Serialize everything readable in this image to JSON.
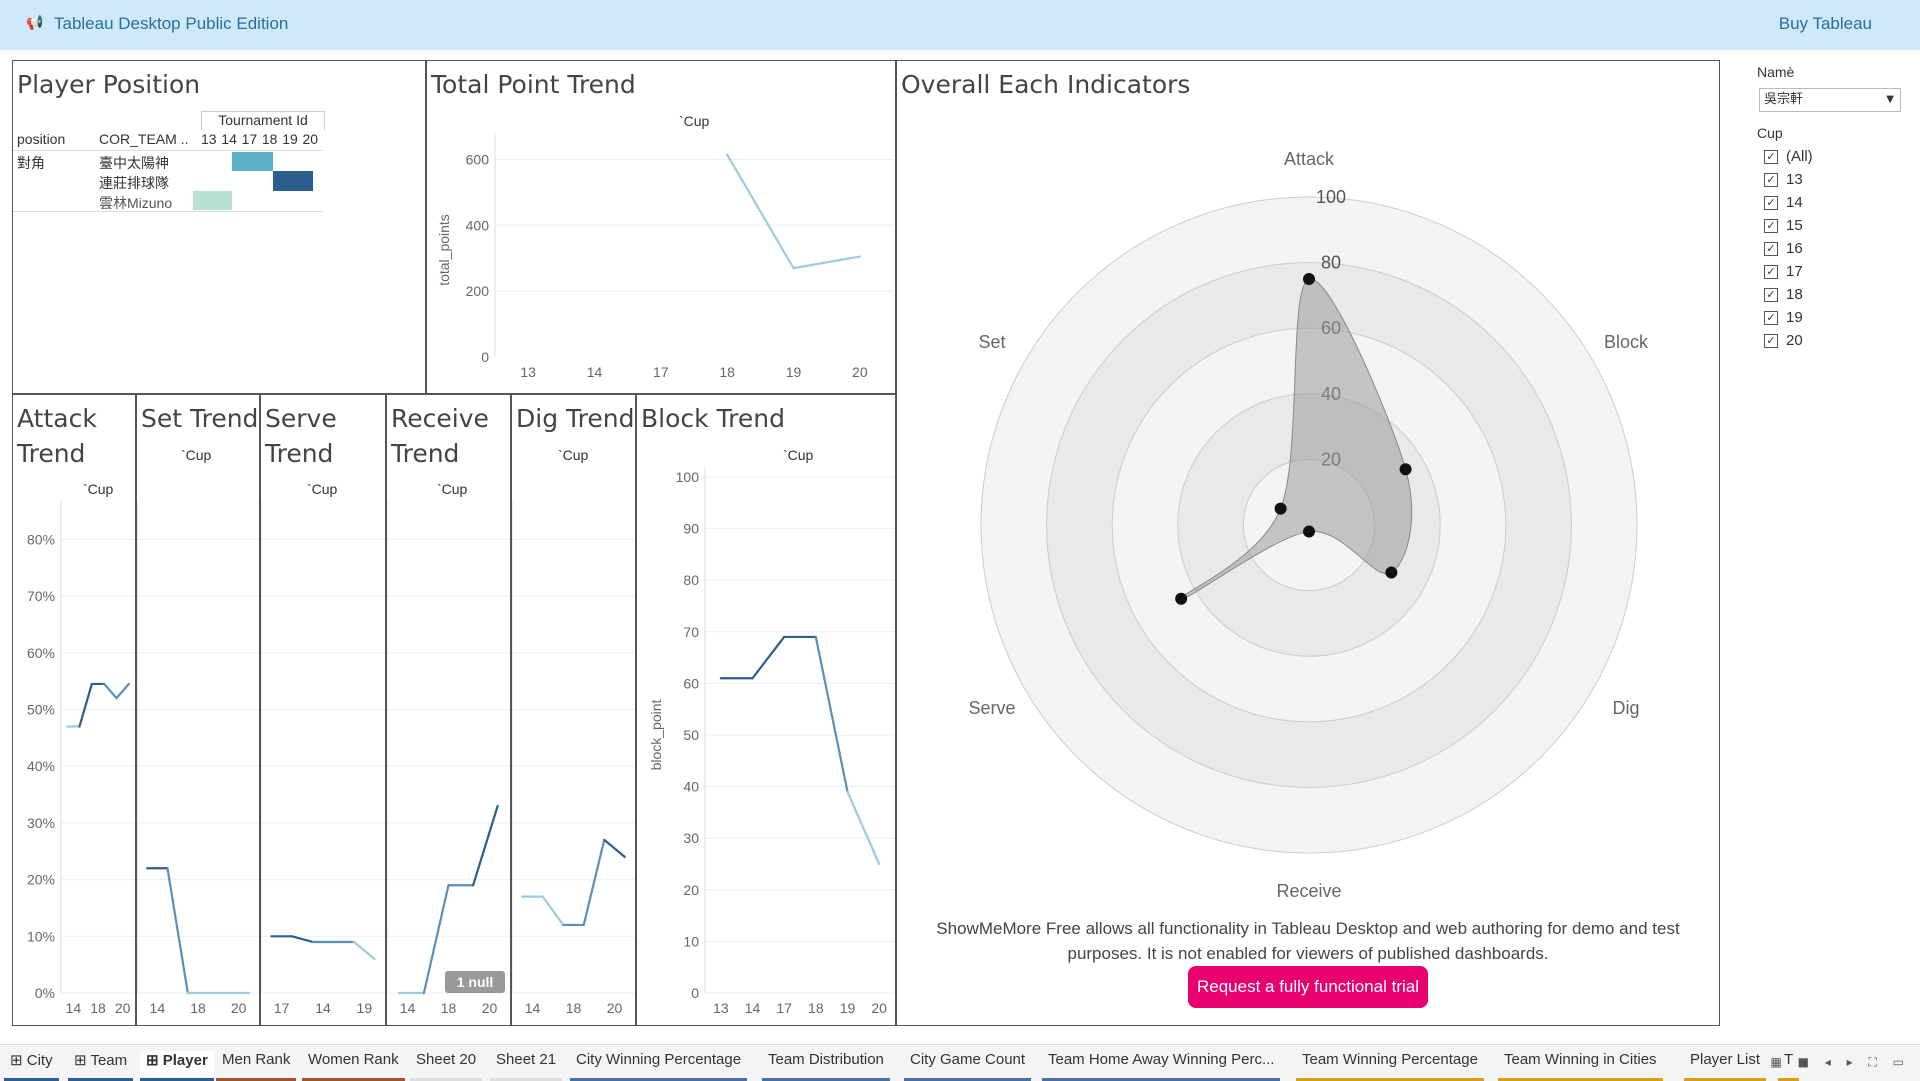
{
  "app": {
    "logo": "📢",
    "title": "Tableau Desktop Public Edition",
    "buy": "Buy Tableau"
  },
  "player_position": {
    "title": "Player Position",
    "header_group": "Tournament Id",
    "col_position": "position",
    "col_team": "COR_TEAM ..",
    "tournament_ids": [
      "13",
      "14",
      "17",
      "18",
      "19",
      "20"
    ],
    "position_value": "對角",
    "teams": [
      "臺中太陽神",
      "連莊排球隊",
      "雲林Mizuno"
    ],
    "colors": {
      "teal": "#5fb0c4",
      "navy": "#2c5f8d",
      "mint": "#b8e3d3"
    }
  },
  "total_point": {
    "title": "Total Point Trend",
    "cup": "`Cup",
    "ylabel": "total_points",
    "yticks": [
      "600",
      "400",
      "200",
      "0"
    ],
    "xticks": [
      "13",
      "14",
      "17",
      "18",
      "19",
      "20"
    ]
  },
  "attack": {
    "title1": "Attack",
    "title2": "Trend",
    "cup": "`Cup",
    "yticks": [
      "80%",
      "70%",
      "60%",
      "50%",
      "40%",
      "30%",
      "20%",
      "10%",
      "0%"
    ],
    "xticks": [
      "14",
      "18",
      "20"
    ]
  },
  "set": {
    "title": "Set Trend",
    "cup": "`Cup",
    "xticks": [
      "14",
      "18",
      "20"
    ]
  },
  "serve": {
    "title1": "Serve",
    "title2": "Trend",
    "cup": "`Cup",
    "xticks": [
      "17",
      "14",
      "19"
    ]
  },
  "receive": {
    "title1": "Receive",
    "title2": "Trend",
    "cup": "`Cup",
    "xticks": [
      "14",
      "18",
      "20"
    ],
    "null_badge": "1 null"
  },
  "dig": {
    "title": "Dig Trend",
    "cup": "`Cup",
    "xticks": [
      "14",
      "18",
      "20"
    ]
  },
  "block": {
    "title": "Block Trend",
    "cup": "`Cup",
    "ylabel": "block_point",
    "yticks": [
      "100",
      "90",
      "80",
      "70",
      "60",
      "50",
      "40",
      "30",
      "20",
      "10",
      "0"
    ],
    "xticks": [
      "13",
      "14",
      "17",
      "18",
      "19",
      "20"
    ]
  },
  "radar": {
    "title": "Overall Each Indicators",
    "axes": [
      "Attack",
      "Block",
      "Dig",
      "Receive",
      "Serve",
      "Set"
    ],
    "rings": [
      "100",
      "80",
      "60",
      "40",
      "20"
    ]
  },
  "promo": {
    "text": "ShowMeMore Free allows all functionality in Tableau Desktop and web authoring for demo and test purposes. It is not enabled for viewers of published dashboards.",
    "button": "Request a fully functional trial"
  },
  "filters": {
    "name_label": "Namè",
    "name_value": "吳宗軒",
    "cup_label": "Cup",
    "cup_options": [
      "(All)",
      "13",
      "14",
      "15",
      "16",
      "17",
      "18",
      "19",
      "20"
    ],
    "check": "✓"
  },
  "tabs": [
    {
      "label": "City",
      "icon": "⊞",
      "color": "#2c5f8d"
    },
    {
      "label": "Team",
      "icon": "⊞",
      "color": "#2c5f8d"
    },
    {
      "label": "Player",
      "icon": "⊞",
      "color": "#2c5f8d"
    },
    {
      "label": "Men Rank",
      "icon": "",
      "color": "#a0522d"
    },
    {
      "label": "Women Rank",
      "icon": "",
      "color": "#a0522d"
    },
    {
      "label": "Sheet 20",
      "icon": "",
      "color": "#ddd"
    },
    {
      "label": "Sheet 21",
      "icon": "",
      "color": "#ddd"
    },
    {
      "label": "City Winning Percentage",
      "icon": "",
      "color": "#4a6fa5"
    },
    {
      "label": "Team Distribution",
      "icon": "",
      "color": "#4a6fa5"
    },
    {
      "label": "City Game Count",
      "icon": "",
      "color": "#4a6fa5"
    },
    {
      "label": "Team Home Away Winning Perc...",
      "icon": "",
      "color": "#4a6fa5"
    },
    {
      "label": "Team Winning Percentage",
      "icon": "",
      "color": "#d4a017"
    },
    {
      "label": "Team Winning in Cities",
      "icon": "",
      "color": "#d4a017"
    },
    {
      "label": "Player List",
      "icon": "",
      "color": "#d4a017"
    },
    {
      "label": "T",
      "icon": "",
      "color": "#d4a017"
    }
  ],
  "chart_data": [
    {
      "type": "line",
      "title": "Total Point Trend",
      "ylabel": "total_points",
      "x": [
        "13",
        "14",
        "17",
        "18",
        "19",
        "20"
      ],
      "ylim": [
        0,
        650
      ],
      "series": [
        {
          "values": [
            null,
            null,
            null,
            615,
            270,
            305
          ]
        }
      ]
    },
    {
      "type": "line",
      "title": "Attack Trend",
      "x": [
        "14",
        "18",
        "20"
      ],
      "ylim": [
        0,
        0.85
      ],
      "series": [
        {
          "values": [
            0.47,
            0.47,
            0.545,
            0.545,
            0.52,
            0.545
          ]
        }
      ]
    },
    {
      "type": "line",
      "title": "Set Trend",
      "x": [
        "14",
        "18",
        "20"
      ],
      "ylim": [
        0,
        0.85
      ],
      "series": [
        {
          "values": [
            0.22,
            0.22,
            0,
            0,
            0,
            0
          ]
        }
      ]
    },
    {
      "type": "line",
      "title": "Serve Trend",
      "x": [
        "17",
        "14",
        "19"
      ],
      "ylim": [
        0,
        0.85
      ],
      "series": [
        {
          "values": [
            0.1,
            0.1,
            0.09,
            0.09,
            0.09,
            0.06
          ]
        }
      ]
    },
    {
      "type": "line",
      "title": "Receive Trend",
      "x": [
        "14",
        "18",
        "20"
      ],
      "ylim": [
        0,
        0.85
      ],
      "series": [
        {
          "values": [
            0,
            0,
            0.19,
            0.19,
            0.33
          ]
        }
      ]
    },
    {
      "type": "line",
      "title": "Dig Trend",
      "x": [
        "14",
        "18",
        "20"
      ],
      "ylim": [
        0,
        0.85
      ],
      "series": [
        {
          "values": [
            0.17,
            0.17,
            0.12,
            0.12,
            0.27,
            0.24
          ]
        }
      ]
    },
    {
      "type": "line",
      "title": "Block Trend",
      "ylabel": "block_point",
      "x": [
        "13",
        "14",
        "17",
        "18",
        "19",
        "20"
      ],
      "ylim": [
        0,
        100
      ],
      "series": [
        {
          "values": [
            61,
            61,
            69,
            69,
            39,
            25
          ]
        }
      ]
    },
    {
      "type": "radar",
      "title": "Overall Each Indicators",
      "axes": [
        "Attack",
        "Block",
        "Dig",
        "Receive",
        "Serve",
        "Set"
      ],
      "rmax": 100,
      "values": [
        75,
        34,
        29,
        2,
        45,
        10
      ]
    }
  ]
}
